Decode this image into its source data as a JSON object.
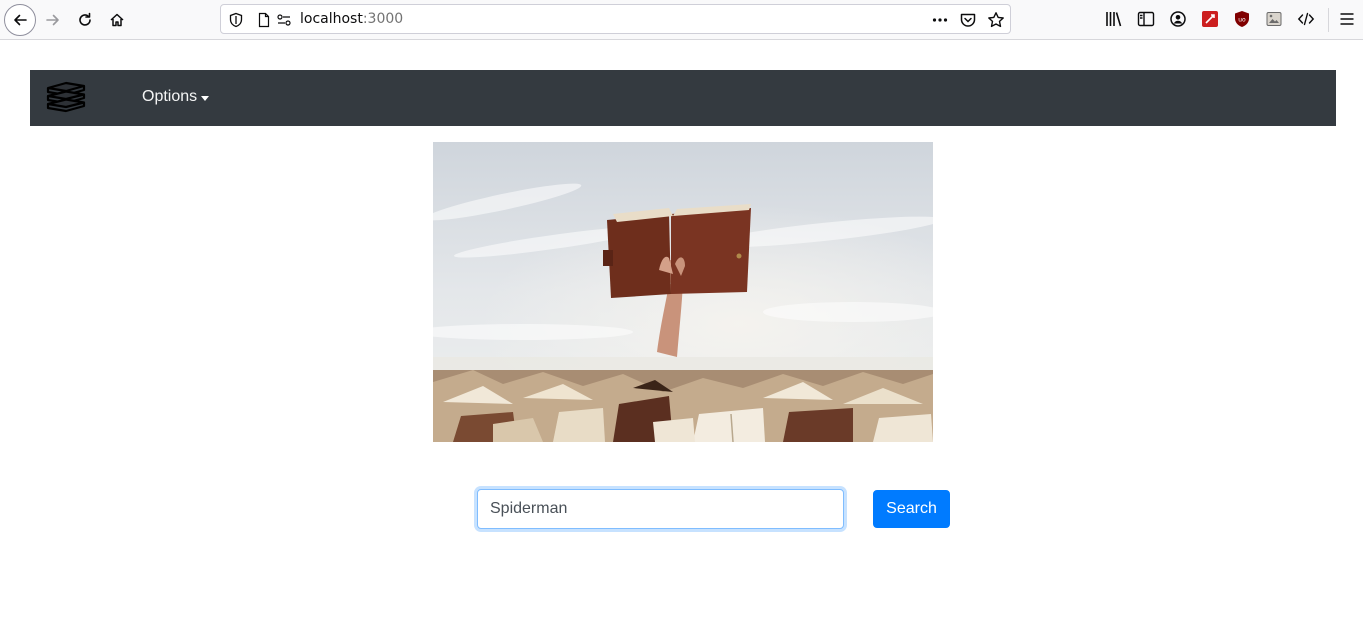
{
  "browser": {
    "url_host": "localhost",
    "url_port": ":3000",
    "icons": [
      "back-icon",
      "forward-icon",
      "reload-icon",
      "home-icon",
      "shield-icon",
      "page-icon",
      "permissions-icon",
      "more-icon",
      "pocket-icon",
      "bookmark-star-icon",
      "library-icon",
      "sidebar-icon",
      "account-icon",
      "extension-icon",
      "ublock-icon",
      "screenshot-icon",
      "devtools-icon",
      "menu-icon"
    ]
  },
  "navbar": {
    "brand_icon": "books-icon",
    "options_label": "Options",
    "background": "#343a40"
  },
  "hero": {
    "image": "hand-holding-book-over-pile-of-books"
  },
  "search": {
    "value": "Spiderman",
    "button_label": "Search",
    "accent": "#007bff"
  }
}
